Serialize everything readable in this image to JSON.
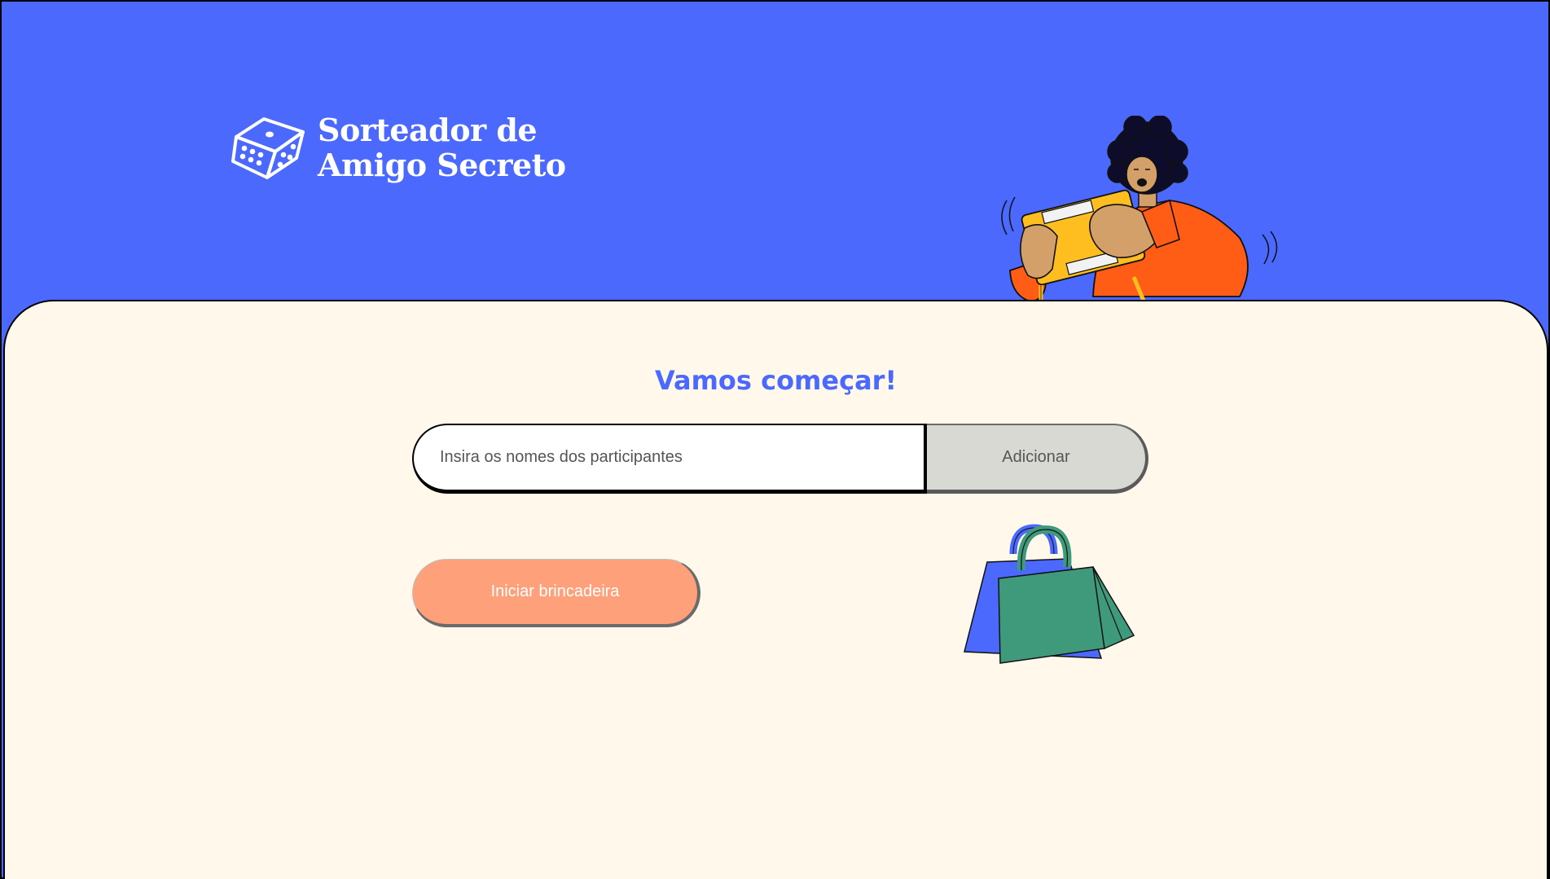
{
  "header": {
    "logo": {
      "line1": "Sorteador de",
      "line2": "Amigo Secreto",
      "icon": "dice-icon"
    },
    "illustration": "person-playing-game-illustration"
  },
  "main": {
    "title": "Vamos começar!",
    "input": {
      "placeholder": "Insira os nomes dos participantes",
      "value": ""
    },
    "add_button_label": "Adicionar",
    "start_button_label": "Iniciar brincadeira",
    "decoration": "shopping-bags-illustration"
  },
  "colors": {
    "header_bg": "#4b69fd",
    "main_bg": "#fff8eb",
    "title": "#4b69fd",
    "start_button": "#fea07a",
    "add_button": "#d9d9d4"
  }
}
